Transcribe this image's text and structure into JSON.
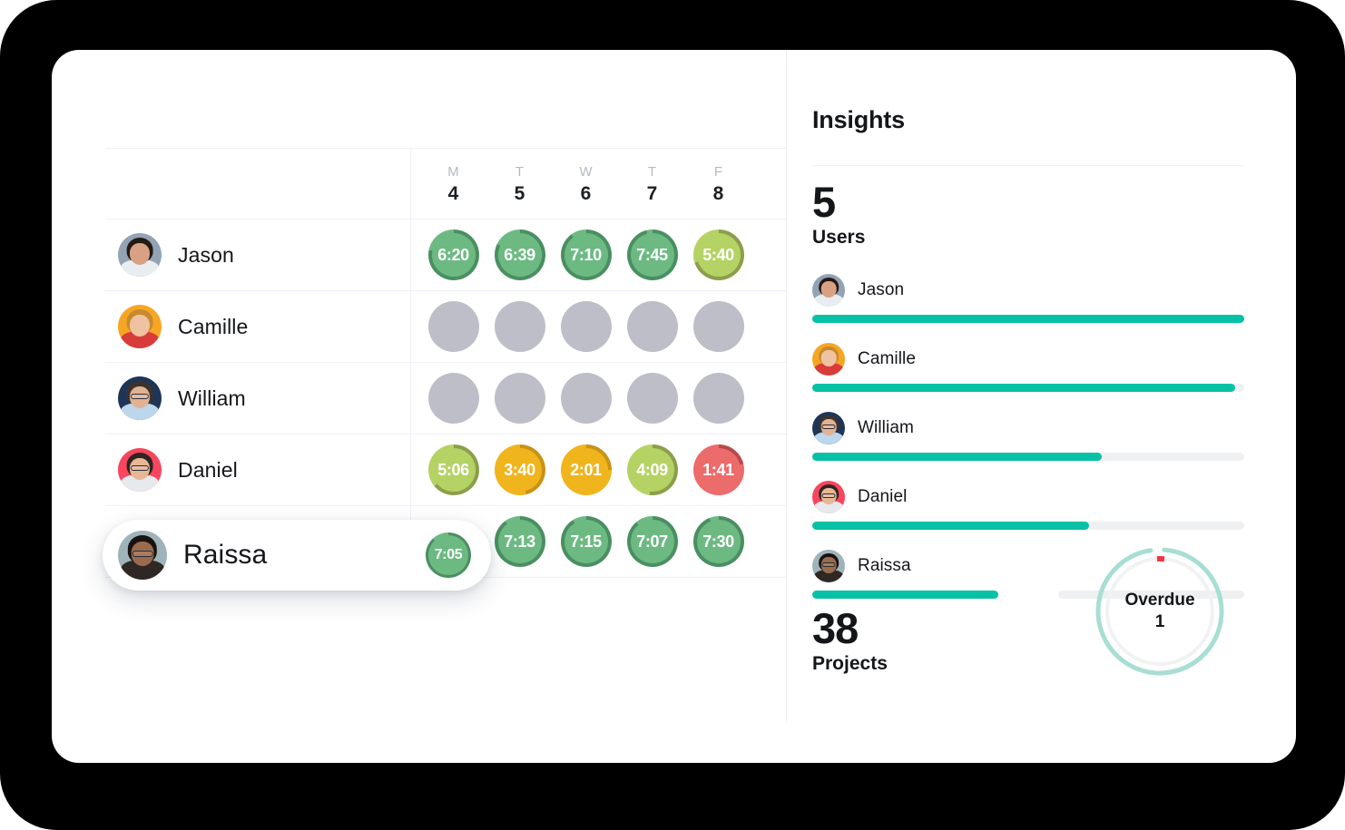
{
  "colors": {
    "teal": "#07c1a6",
    "track_gray": "#eff0f2",
    "green": "#6cba82",
    "green_ring": "#4a8f62",
    "lime": "#b5d265",
    "lime_ring": "#8c9e4a",
    "orange": "#f0b41c",
    "orange_ring": "#c89216",
    "red": "#ec6b6b",
    "red_ring": "#b84a4a",
    "empty_gray": "#bdbec7",
    "donut_teal": "#a8ded4",
    "donut_inner": "#f1f2f3",
    "donut_red": "#f2353f",
    "divider": "#eef1f7",
    "text_dark": "#14161a",
    "text_muted": "#b3b9c4"
  },
  "timesheet": {
    "days": [
      {
        "dow": "M",
        "num": "4"
      },
      {
        "dow": "T",
        "num": "5"
      },
      {
        "dow": "W",
        "num": "6"
      },
      {
        "dow": "T",
        "num": "7"
      },
      {
        "dow": "F",
        "num": "8"
      }
    ],
    "rows": [
      {
        "name": "Jason",
        "avatar": "avatar-jason",
        "cells": [
          {
            "value": "6:20",
            "state": "good",
            "arc": 78
          },
          {
            "value": "6:39",
            "state": "good",
            "arc": 82
          },
          {
            "value": "7:10",
            "state": "good",
            "arc": 90
          },
          {
            "value": "7:45",
            "state": "good",
            "arc": 96
          },
          {
            "value": "5:40",
            "state": "warn",
            "arc": 70
          }
        ]
      },
      {
        "name": "Camille",
        "avatar": "avatar-camille",
        "cells": [
          {
            "value": "",
            "state": "empty",
            "arc": 0
          },
          {
            "value": "",
            "state": "empty",
            "arc": 0
          },
          {
            "value": "",
            "state": "empty",
            "arc": 0
          },
          {
            "value": "",
            "state": "empty",
            "arc": 0
          },
          {
            "value": "",
            "state": "empty",
            "arc": 0
          }
        ]
      },
      {
        "name": "William",
        "avatar": "avatar-william",
        "cells": [
          {
            "value": "",
            "state": "empty",
            "arc": 0
          },
          {
            "value": "",
            "state": "empty",
            "arc": 0
          },
          {
            "value": "",
            "state": "empty",
            "arc": 0
          },
          {
            "value": "",
            "state": "empty",
            "arc": 0
          },
          {
            "value": "",
            "state": "empty",
            "arc": 0
          }
        ]
      },
      {
        "name": "Daniel",
        "avatar": "avatar-daniel",
        "cells": [
          {
            "value": "5:06",
            "state": "warn",
            "arc": 64
          },
          {
            "value": "3:40",
            "state": "low",
            "arc": 46
          },
          {
            "value": "2:01",
            "state": "low",
            "arc": 25
          },
          {
            "value": "4:09",
            "state": "warn",
            "arc": 52
          },
          {
            "value": "1:41",
            "state": "bad",
            "arc": 21
          }
        ]
      },
      {
        "name": "Raissa",
        "avatar": "avatar-raissa",
        "highlighted": true,
        "cells": [
          {
            "value": "7:05",
            "state": "good",
            "arc": 88
          },
          {
            "value": "7:13",
            "state": "good",
            "arc": 90
          },
          {
            "value": "7:15",
            "state": "good",
            "arc": 91
          },
          {
            "value": "7:07",
            "state": "good",
            "arc": 89
          },
          {
            "value": "7:30",
            "state": "good",
            "arc": 94
          }
        ]
      }
    ]
  },
  "insights": {
    "title": "Insights",
    "users_stat": {
      "value": "5",
      "label": "Users"
    },
    "projects_stat": {
      "value": "38",
      "label": "Projects"
    },
    "users": [
      {
        "name": "Jason",
        "avatar": "avatar-jason",
        "percent": 100
      },
      {
        "name": "Camille",
        "avatar": "avatar-camille",
        "percent": 98
      },
      {
        "name": "William",
        "avatar": "avatar-william",
        "percent": 67
      },
      {
        "name": "Daniel",
        "avatar": "avatar-daniel",
        "percent": 64
      },
      {
        "name": "Raissa",
        "avatar": "avatar-raissa",
        "percent": 43,
        "track_start": 57
      }
    ],
    "overdue": {
      "label": "Overdue",
      "count": "1"
    }
  }
}
